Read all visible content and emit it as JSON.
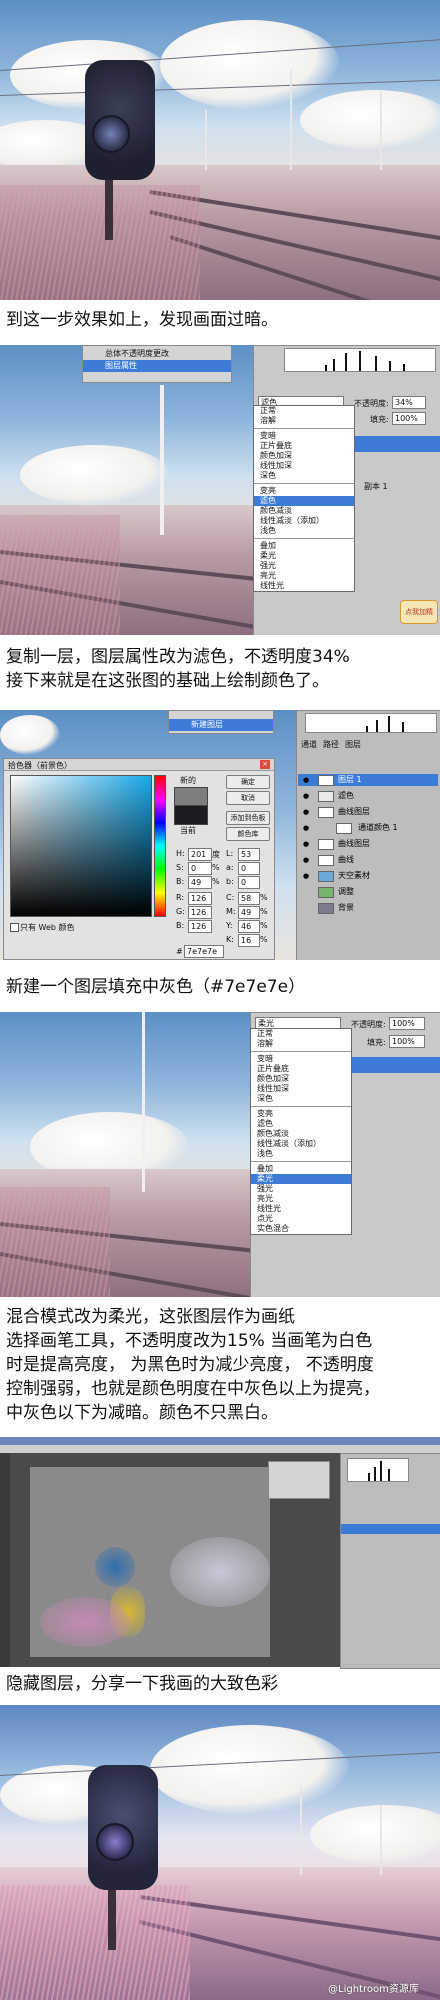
{
  "captions": {
    "c1": "到这一步效果如上，发现画面过暗。",
    "c2_line1": "复制一层，图层属性改为滤色，不透明度34%",
    "c2_line2": "接下来就是在这张图的基础上绘制颜色了。",
    "c3": "新建一个图层填充中灰色（#7e7e7e）",
    "c4_line1": "混合模式改为柔光，这张图层作为画纸",
    "c4_line2": "选择画笔工具，不透明度改为15% 当画笔为白色",
    "c4_line3": "时是提高亮度，  为黑色时为减少亮度，  不透明度",
    "c4_line4": "控制强弱，也就是颜色明度在中灰色以上为提亮，",
    "c4_line5": "中灰色以下为减暗。颜色不只黑白。",
    "c5": "隐藏图层，分享一下我画的大致色彩"
  },
  "panel1": {
    "history_items": [
      "总体不透明度更改",
      "图层属性"
    ],
    "blend_value": "滤色",
    "opacity_label": "不透明度:",
    "opacity_value": "34%",
    "fill_label": "填充:",
    "fill_value": "100%",
    "blend_modes": [
      "正常",
      "溶解",
      "变暗",
      "正片叠底",
      "颜色加深",
      "线性加深",
      "深色",
      "变亮",
      "滤色",
      "颜色减淡",
      "线性减淡（添加）",
      "浅色",
      "叠加",
      "柔光",
      "强光",
      "亮光",
      "线性光"
    ],
    "layer_label": "副本 1",
    "badge": "点我加精"
  },
  "panel2": {
    "picker_title": "拾色器（前景色）",
    "new_label": "新的",
    "current_label": "当前",
    "buttons": [
      "确定",
      "取消",
      "添加到色板",
      "颜色库"
    ],
    "fields": [
      {
        "k": "H:",
        "v": "201",
        "u": "度"
      },
      {
        "k": "S:",
        "v": "0",
        "u": "%"
      },
      {
        "k": "B:",
        "v": "49",
        "u": "%"
      },
      {
        "k": "R:",
        "v": "126",
        "u": ""
      },
      {
        "k": "G:",
        "v": "126",
        "u": ""
      },
      {
        "k": "B:",
        "v": "126",
        "u": ""
      }
    ],
    "lab_fields": [
      {
        "k": "L:",
        "v": "53"
      },
      {
        "k": "a:",
        "v": "0"
      },
      {
        "k": "b:",
        "v": "0"
      },
      {
        "k": "C:",
        "v": "58",
        "u": "%"
      },
      {
        "k": "M:",
        "v": "49",
        "u": "%"
      },
      {
        "k": "Y:",
        "v": "46",
        "u": "%"
      },
      {
        "k": "K:",
        "v": "16",
        "u": "%"
      }
    ],
    "hex": "7e7e7e",
    "web_only": "只有 Web 颜色",
    "layers": [
      "图层 1",
      "滤色",
      "曲线图层",
      "通道颜色 1",
      "曲线图层",
      "曲线",
      "天空素材",
      "调整",
      "背景",
      "曲线"
    ],
    "history_items": [
      "新建图层"
    ],
    "tabs": [
      "通道",
      "路径",
      "图层"
    ]
  },
  "panel3": {
    "blend_value": "柔光",
    "opacity_label": "不透明度:",
    "opacity_value": "100%",
    "fill_label": "填充:",
    "fill_value": "100%",
    "blend_modes": [
      "正常",
      "溶解",
      "变暗",
      "正片叠底",
      "颜色加深",
      "线性加深",
      "深色",
      "变亮",
      "滤色",
      "颜色减淡",
      "线性减淡（添加）",
      "浅色",
      "叠加",
      "柔光",
      "强光",
      "亮光",
      "线性光",
      "点光",
      "实色混合"
    ]
  },
  "watermark": "@Lightroom资源库",
  "colors": {
    "gray_fill": "#7e7e7e",
    "selection": "#3d7bd9"
  }
}
